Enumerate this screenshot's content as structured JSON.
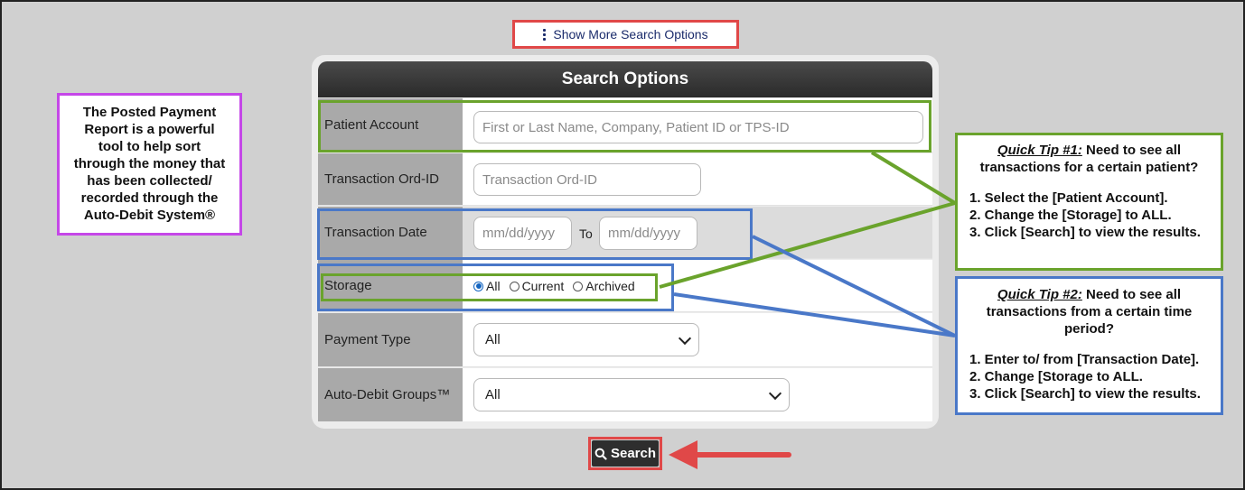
{
  "top": {
    "show_more_label": "Show More Search Options"
  },
  "panel": {
    "title": "Search Options",
    "rows": {
      "patient_account": {
        "label": "Patient Account",
        "placeholder": "First or Last Name, Company, Patient ID or TPS-ID"
      },
      "transaction_ord_id": {
        "label": "Transaction Ord-ID",
        "placeholder": "Transaction Ord-ID"
      },
      "transaction_date": {
        "label": "Transaction Date",
        "from_placeholder": "mm/dd/yyyy",
        "to_label": "To",
        "to_placeholder": "mm/dd/yyyy"
      },
      "storage": {
        "label": "Storage",
        "options": [
          "All",
          "Current",
          "Archived"
        ],
        "selected": "All"
      },
      "payment_type": {
        "label": "Payment Type",
        "value": "All"
      },
      "auto_debit_groups": {
        "label": "Auto-Debit Groups™",
        "value": "All"
      }
    }
  },
  "search_button": {
    "label": "Search"
  },
  "notes": {
    "posted_payment": "The Posted Payment Report is a powerful tool to help sort through the money that has been collected/ recorded through the Auto-Debit System®",
    "tip1": {
      "title": "Quick Tip #1:",
      "text": " Need to see all transactions for a certain patient?",
      "steps": [
        "1. Select the [Patient Account].",
        "2. Change the [Storage] to ALL.",
        "3. Click [Search] to view the results."
      ]
    },
    "tip2": {
      "title": "Quick Tip #2:",
      "text": " Need to see all transactions from a certain time period?",
      "steps": [
        "1. Enter to/ from [Transaction Date].",
        "2. Change [Storage to ALL.",
        "3. Click [Search] to view the results."
      ]
    }
  },
  "colors": {
    "green": "#6aa32c",
    "blue": "#4a78c8",
    "red": "#e04848",
    "purple": "#c547e8"
  }
}
